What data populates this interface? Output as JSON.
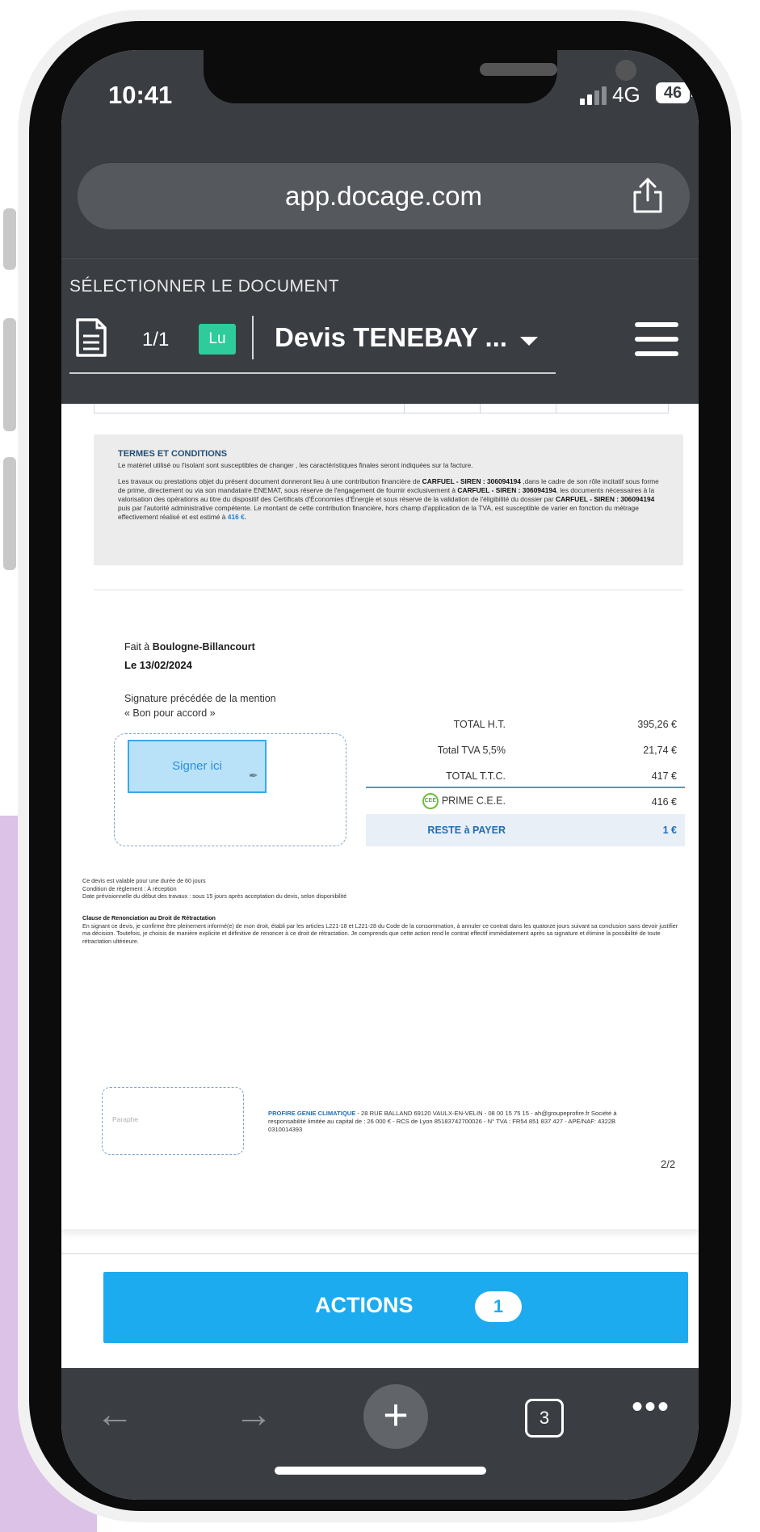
{
  "status": {
    "time": "10:41",
    "network": "4G",
    "battery": "46"
  },
  "browser": {
    "url": "app.docage.com"
  },
  "header": {
    "select_label": "SÉLECTIONNER LE DOCUMENT",
    "page_count": "1/1",
    "read_badge": "Lu",
    "doc_title": "Devis TENEBAY ..."
  },
  "document": {
    "terms_title": "TERMES ET CONDITIONS",
    "terms_line1": "Le matériel utilisé ou l'isolant sont susceptibles de changer , les caractéristiques finales seront indiquées sur la facture.",
    "terms_p2_a": "Les travaux ou prestations objet du présent document donneront lieu à une contribution financière de ",
    "terms_p2_b": "CARFUEL - SIREN : 306094194",
    "terms_p2_c": " ,dans le cadre de son rôle incitatif sous forme de prime, directement ou via son mandataire ENEMAT, sous réserve de l'engagement de fournir exclusivement à ",
    "terms_p2_d": "CARFUEL - SIREN : 306094194",
    "terms_p2_e": ", les documents nécessaires à la valorisation des opérations au titre du dispositif des Certificats d'Économies d'Énergie et sous réserve de la validation de l'éligibilité du dossier par ",
    "terms_p2_f": "CARFUEL - SIREN : 306094194",
    "terms_p2_g": " puis par l'autorité administrative compétente. Le montant de cette contribution financière, hors champ d'application de la TVA, est susceptible de varier en fonction du métrage effectivement réalisé et est estimé à ",
    "terms_p2_h": "416 €.",
    "place_prefix": "Fait à ",
    "place": "Boulogne-Billancourt",
    "date": "Le  13/02/2024",
    "sig_mention_1": "Signature précédée de la mention",
    "sig_mention_2": "« Bon pour accord »",
    "sign_here": "Signer ici",
    "totals": {
      "ht_label": "TOTAL H.T.",
      "ht_value": "395,26 €",
      "tva_label": "Total TVA 5,5%",
      "tva_value": "21,74 €",
      "ttc_label": "TOTAL T.T.C.",
      "ttc_value": "417 €",
      "prime_logo": "CEE",
      "prime_label": "PRIME C.E.E.",
      "prime_value": "416 €",
      "reste_label": "RESTE à PAYER",
      "reste_value": "1 €"
    },
    "validity_1": "Ce devis est valable pour une durée de 60 jours",
    "validity_2": "Condition de règlement : À réception",
    "validity_3": "Date prévisionnelle du début des travaux : sous 15 jours après acceptation du devis, selon disponibilité",
    "clause_title": "Clause de Renonciation au Droit de Rétractation",
    "clause_text": "En signant ce devis, je confirme être pleinement informé(e) de mon droit, établi par les articles L221-18 et L221-28 du Code de la consommation, à annuler ce contrat dans les quatorze jours suivant sa conclusion sans devoir justifier ma décision. Toutefois, je choisis de manière explicite et définitive de renoncer à ce droit de rétractation. Je comprends que cette action rend le contrat effectif immédiatement après sa signature et élimine la possibilité de toute rétractation ultérieure.",
    "paraphe": "Paraphe",
    "company_name": "PROFIRE GENIE CLIMATIQUE",
    "company_text": " - 28 RUE BALLAND 69120 VAULX-EN-VELIN - 08 00 15 75 15 - ah@groupeprofire.fr Société à responsabilité limitée au capital de : 26 000 € - RCS de Lyon 85183742700026 - N° TVA : FR54 851 837 427 - APE/NAF: 4322B 0310014393",
    "page_number": "2/2"
  },
  "actions": {
    "label": "ACTIONS",
    "count": "1"
  },
  "toolbar": {
    "back": "←",
    "forward": "→",
    "new_tab": "+",
    "tabs_count": "3",
    "more": "•••"
  },
  "colors": {
    "accent": "#1dabf0",
    "badge_green": "#2ecc9a",
    "chrome_dark": "#3a3d42"
  }
}
